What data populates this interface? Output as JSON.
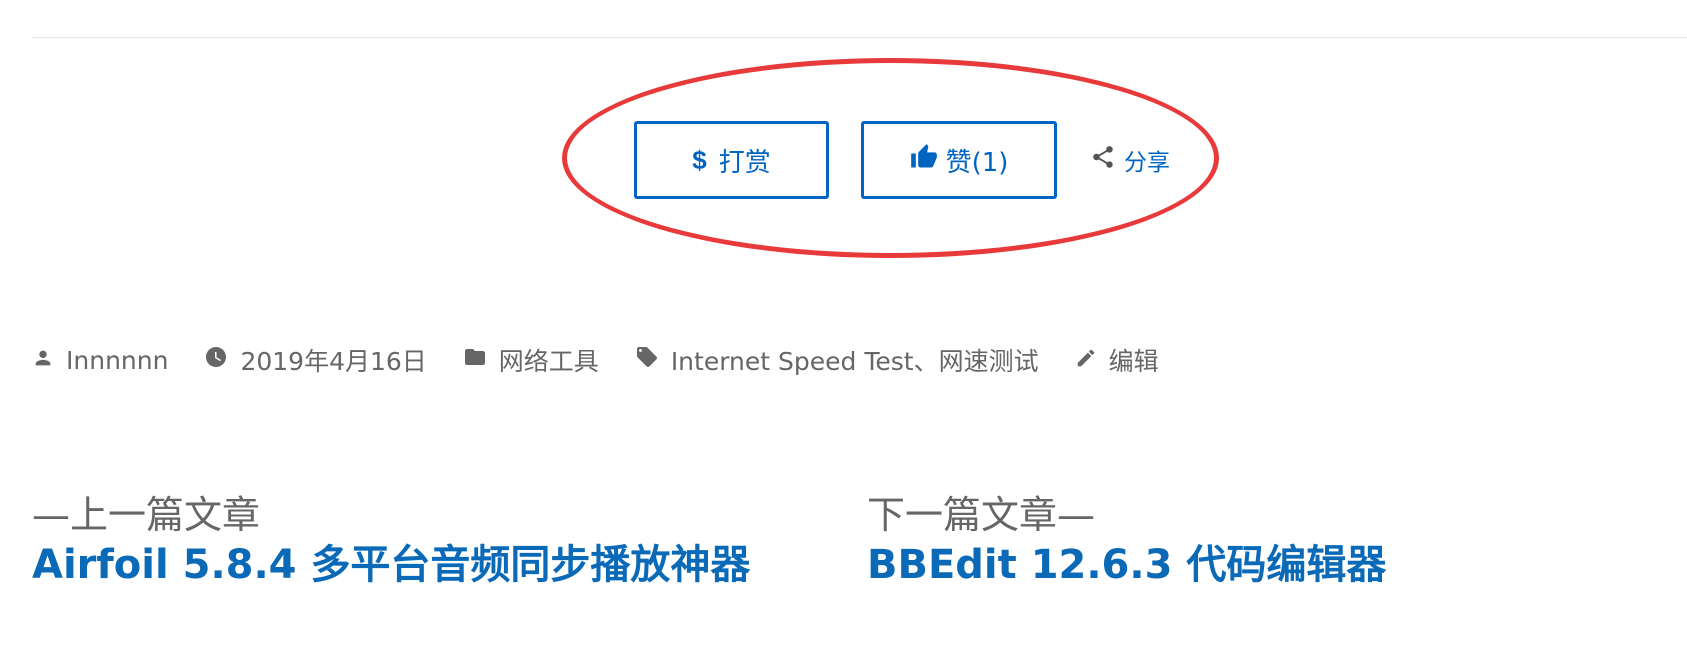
{
  "actions": {
    "reward_icon": "$",
    "reward_label": "打赏",
    "like_label": "赞(1)",
    "share_label": "分享"
  },
  "meta": {
    "author": "Innnnnn",
    "date": "2019年4月16日",
    "category": "网络工具",
    "tags": "Internet Speed Test、网速测试",
    "edit_label": "编辑"
  },
  "post_navigation": {
    "previous": {
      "label": "—上一篇文章",
      "title": "Airfoil 5.8.4 多平台音频同步播放神器"
    },
    "next": {
      "label": "下一篇文章—",
      "title": "BBEdit 12.6.3 代码编辑器"
    }
  },
  "colors": {
    "accent": "#0064c1",
    "link": "#0a6ab8",
    "meta_text": "#666666",
    "highlight_ellipse": "#e83a3a",
    "rule": "#e6e6e6"
  },
  "icons": {
    "reward": "dollar-icon",
    "like": "thumbs-up-icon",
    "share": "share-icon",
    "author": "person-icon",
    "date": "clock-icon",
    "category": "folder-icon",
    "tags": "tag-icon",
    "edit": "pencil-icon"
  }
}
